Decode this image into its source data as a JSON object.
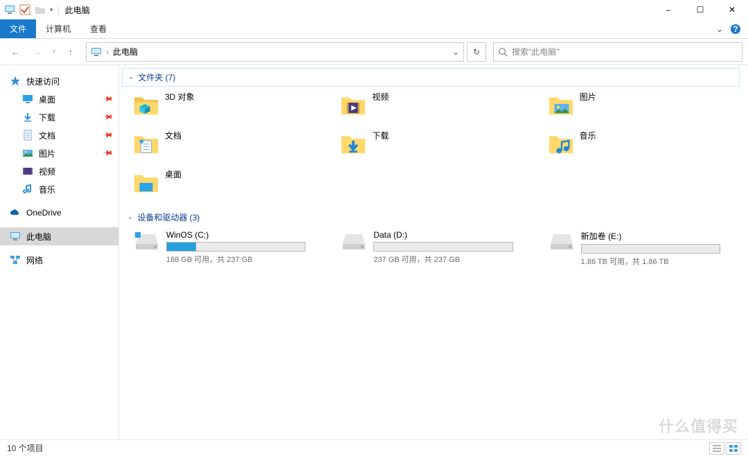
{
  "window": {
    "title": "此电脑",
    "minimize": "–",
    "maximize": "☐",
    "close": "✕"
  },
  "ribbon": {
    "file": "文件",
    "computer": "计算机",
    "view": "查看"
  },
  "nav": {
    "address_label": "此电脑",
    "search_placeholder": "搜索\"此电脑\""
  },
  "sidebar": {
    "quick_access": "快速访问",
    "desktop": "桌面",
    "downloads": "下载",
    "documents": "文档",
    "pictures": "图片",
    "videos": "视频",
    "music": "音乐",
    "onedrive": "OneDrive",
    "this_pc": "此电脑",
    "network": "网络"
  },
  "groups": {
    "folders": {
      "label": "文件夹 (7)"
    },
    "drives": {
      "label": "设备和驱动器 (3)"
    }
  },
  "folders": {
    "objects3d": "3D 对象",
    "videos": "视频",
    "pictures": "图片",
    "documents": "文档",
    "downloads": "下载",
    "music": "音乐",
    "desktop": "桌面"
  },
  "drives": [
    {
      "name": "WinOS (C:)",
      "free": "188 GB 可用，共 237 GB",
      "used_pct": 21
    },
    {
      "name": "Data (D:)",
      "free": "237 GB 可用，共 237 GB",
      "used_pct": 0
    },
    {
      "name": "新加卷 (E:)",
      "free": "1.86 TB 可用，共 1.86 TB",
      "used_pct": 0
    }
  ],
  "status": {
    "items": "10 个项目"
  },
  "watermark": "什么值得买"
}
